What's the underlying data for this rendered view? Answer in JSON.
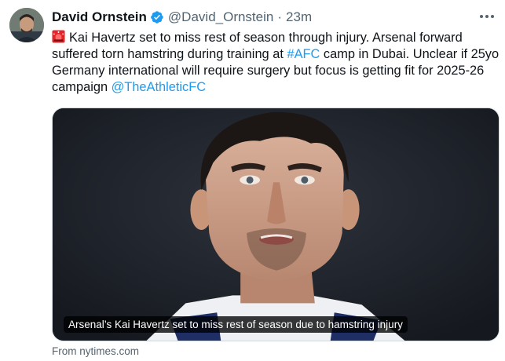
{
  "author": {
    "name": "David Ornstein",
    "handle": "@David_Ornstein",
    "separator": "·",
    "time": "23m"
  },
  "tweet": {
    "text_part1": "Kai Havertz set to miss rest of season through injury. Arsenal forward suffered torn hamstring during training at ",
    "hashtag": "#AFC",
    "text_part2": " camp in Dubai. Unclear if 25yo Germany international will require surgery but focus is getting fit for 2025-26 campaign ",
    "mention": "@TheAthleticFC"
  },
  "card": {
    "caption": "Arsenal’s Kai Havertz set to miss rest of season due to hamstring injury",
    "source": "From nytimes.com"
  },
  "icons": {
    "verified": "verified-badge-icon",
    "siren": "police-light-emoji-icon",
    "more": "more-options-icon"
  },
  "colors": {
    "link": "#1d9bf0",
    "secondary_text": "#536471",
    "verified_blue": "#1d9bf0"
  }
}
